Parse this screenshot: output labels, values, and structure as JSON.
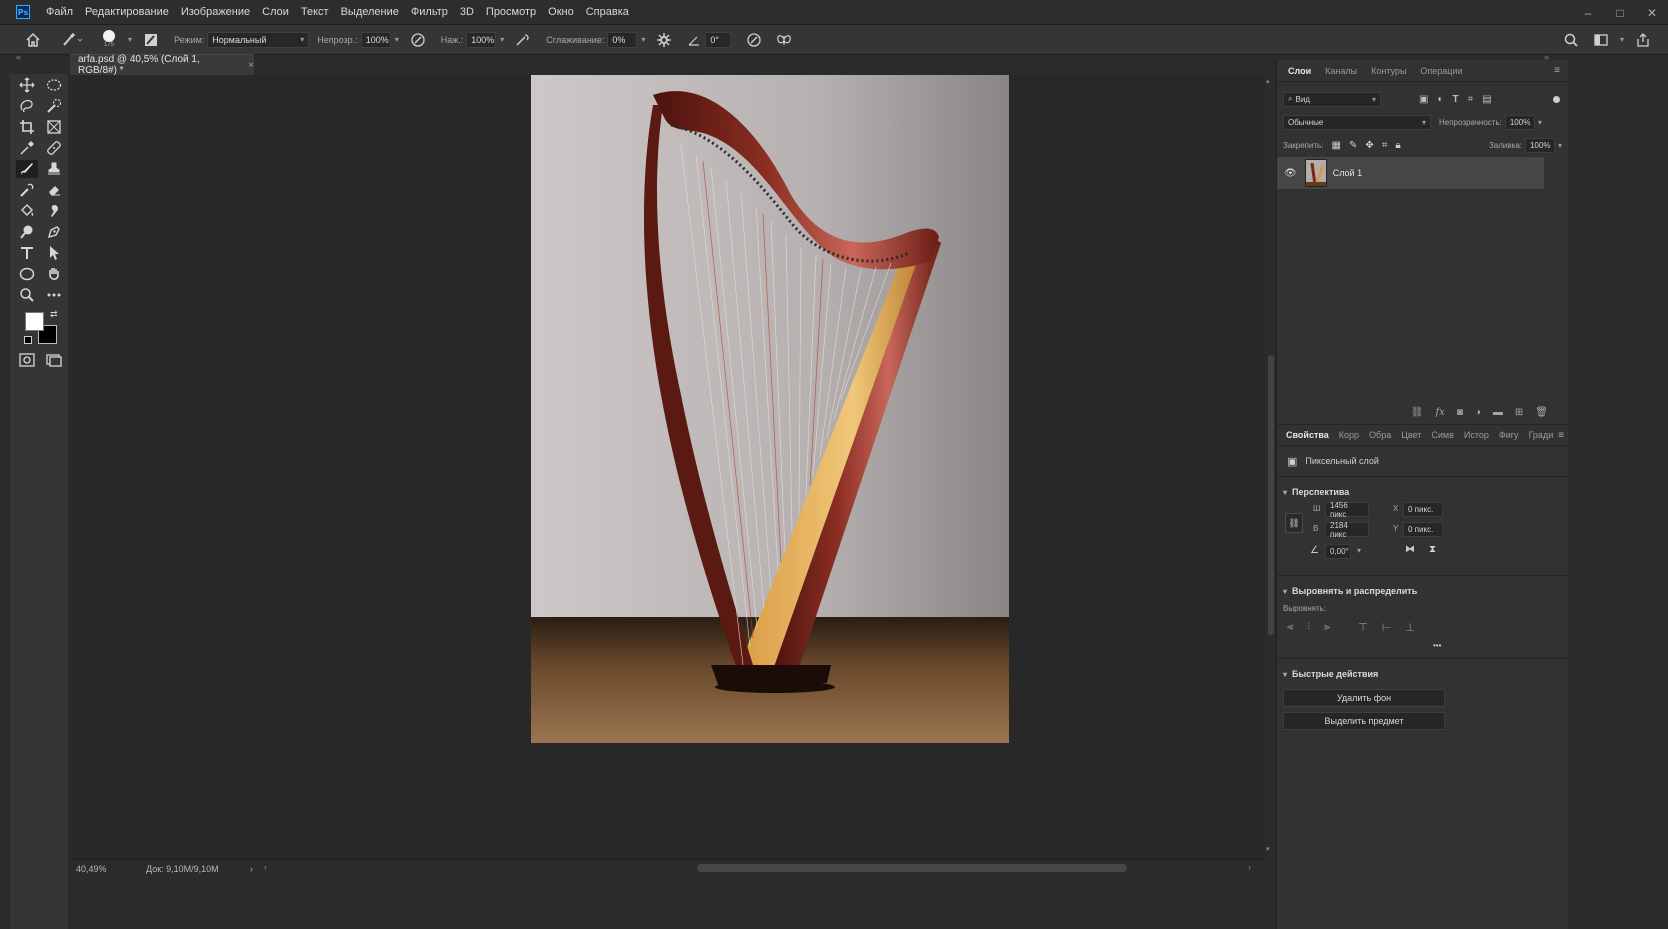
{
  "app": {
    "logo": "Ps"
  },
  "menu": {
    "items": [
      "Файл",
      "Редактирование",
      "Изображение",
      "Слои",
      "Текст",
      "Выделение",
      "Фильтр",
      "3D",
      "Просмотр",
      "Окно",
      "Справка"
    ]
  },
  "window_controls": {
    "minimize": "–",
    "maximize": "□",
    "close": "✕"
  },
  "options": {
    "brush_size": "175",
    "mode_label": "Режим:",
    "mode_value": "Нормальный",
    "opacity_label": "Непрозр.:",
    "opacity_value": "100%",
    "pressure_label": "Наж.:",
    "pressure_value": "100%",
    "smoothing_label": "Сглаживание:",
    "smoothing_value": "0%",
    "angle_value": "0°"
  },
  "document": {
    "tab_title": "arfa.psd @ 40,5% (Слой 1, RGB/8#) *",
    "close": "×"
  },
  "status": {
    "zoom": "40,49%",
    "doc": "Док: 9,10M/9,10M"
  },
  "layers_panel": {
    "tabs": [
      "Слои",
      "Каналы",
      "Контуры",
      "Операции"
    ],
    "filter_value": "Вид",
    "blend_mode": "Обычные",
    "opacity_label": "Непрозрачность:",
    "opacity_value": "100%",
    "lock_label": "Закрепить:",
    "fill_label": "Заливка:",
    "fill_value": "100%",
    "layers": [
      {
        "name": "Слой 1",
        "visible": true
      }
    ]
  },
  "properties_panel": {
    "tabs": [
      "Свойства",
      "Корр",
      "Обра",
      "Цвет",
      "Симв",
      "Истор",
      "Фигу",
      "Гради"
    ],
    "type_label": "Пиксельный слой",
    "perspective": {
      "title": "Перспектива",
      "w_label": "Ш",
      "w_value": "1456 пикс",
      "h_label": "В",
      "h_value": "2184 пикс",
      "x_label": "X",
      "x_value": "0 пикс.",
      "y_label": "Y",
      "y_value": "0 пикс.",
      "angle_value": "0,00°"
    },
    "align": {
      "title": "Выровнять и распределить",
      "sub_label": "Выровнять:",
      "more": "•••"
    },
    "quick_actions": {
      "title": "Быстрые действия",
      "remove_bg": "Удалить фон",
      "select_subject": "Выделить предмет"
    }
  },
  "colors": {
    "background": "#2b2b2b",
    "panel": "#323232",
    "accent": "#31a8ff",
    "foreground_swatch": "#ffffff",
    "background_swatch": "#000000"
  }
}
